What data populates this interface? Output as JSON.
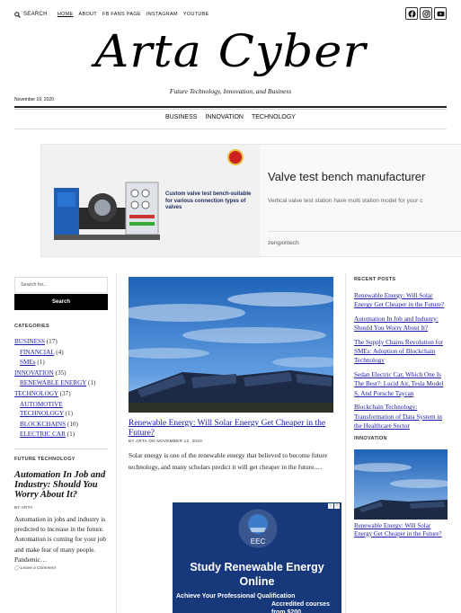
{
  "topbar": {
    "search_label": "SEARCH",
    "nav": [
      "HOME",
      "ABOUT",
      "FB FANS PAGE",
      "INSTAGRAM",
      "YOUTUBE"
    ],
    "social_icons": [
      "facebook-icon",
      "instagram-icon",
      "youtube-icon"
    ]
  },
  "site": {
    "title": "Arta Cyber",
    "tagline": "Future Technology, Innovation, and Business",
    "date": "November 19, 2020"
  },
  "main_nav": [
    "BUSINESS",
    "INNOVATION",
    "TECHNOLOGY"
  ],
  "ad_banner": {
    "caption": "Custom valve test bench-suitable for various connection types of valves",
    "headline": "Valve test bench manufacturer",
    "description": "Vertical valve test station have multi station model for your c",
    "advertiser": "zengxintech"
  },
  "left_sidebar": {
    "search_placeholder": "Search for...",
    "search_button": "Search",
    "categories_title": "CATEGORIES",
    "categories": [
      {
        "name": "BUSINESS",
        "count": "(17)",
        "sub": false
      },
      {
        "name": "FINANCIAL",
        "count": "(4)",
        "sub": true
      },
      {
        "name": "SMEs",
        "count": "(1)",
        "sub": true
      },
      {
        "name": "INNOVATION",
        "count": "(35)",
        "sub": false
      },
      {
        "name": "RENEWABLE ENERGY",
        "count": "(1)",
        "sub": true
      },
      {
        "name": "TECHNOLOGY",
        "count": "(37)",
        "sub": false
      },
      {
        "name": "AUTOMOTIVE TECHNOLOGY",
        "count": "(1)",
        "sub": true
      },
      {
        "name": "BLOCKCHAINS",
        "count": "(10)",
        "sub": true
      },
      {
        "name": "ELECTRIC CAR",
        "count": "(1)",
        "sub": true
      }
    ],
    "future_title": "FUTURE TECHNOLOGY",
    "future_post": {
      "title": "Automation In Job and Industry: Should You Worry About It?",
      "byline": "BY ARTA",
      "excerpt": "Automation in jobs and industry is predicted to increase in the future. Automation is coming for your job and make fear of many people. Pandemic…",
      "comment": "Leave a Comment"
    }
  },
  "main_post": {
    "title": "Renewable Energy: Will Solar Energy Get Cheaper in the Future?",
    "meta": "BY ARTA ON NOVEMBER 12, 2020",
    "excerpt": "Solar energy is one of the renewable energy that believed to become future technology, and many scholars predict it will get cheaper in the future.…"
  },
  "ad2": {
    "org": "EEC",
    "headline": "Study Renewable Energy Online",
    "left_text": "Achieve Your Professional Qualification",
    "right_text": "Accredited courses from $200"
  },
  "right_sidebar": {
    "recent_title": "RECENT POSTS",
    "recent": [
      "Renewable Energy: Will Solar Energy Get Cheaper in the Future?",
      "Automation In Job and Industry: Should You Worry About It?",
      "The Supply Chains Revolution for SMEs: Adoption of Blockchain Technology",
      "Sedan Electric Car, Which One Is The Best?: Lucid Air, Tesla Model S, And Porsche Taycan",
      "Blockchain Technology: Transformation of Data System in the Healthcare Sector"
    ],
    "innovation_title": "INNOVATION",
    "innovation_caption": "Renewable Energy: Will Solar Energy Get Cheaper in the Future?"
  },
  "colors": {
    "link": "#1a1aa6",
    "ad2_bg": "#17387a",
    "search_button_bg": "#000000"
  }
}
